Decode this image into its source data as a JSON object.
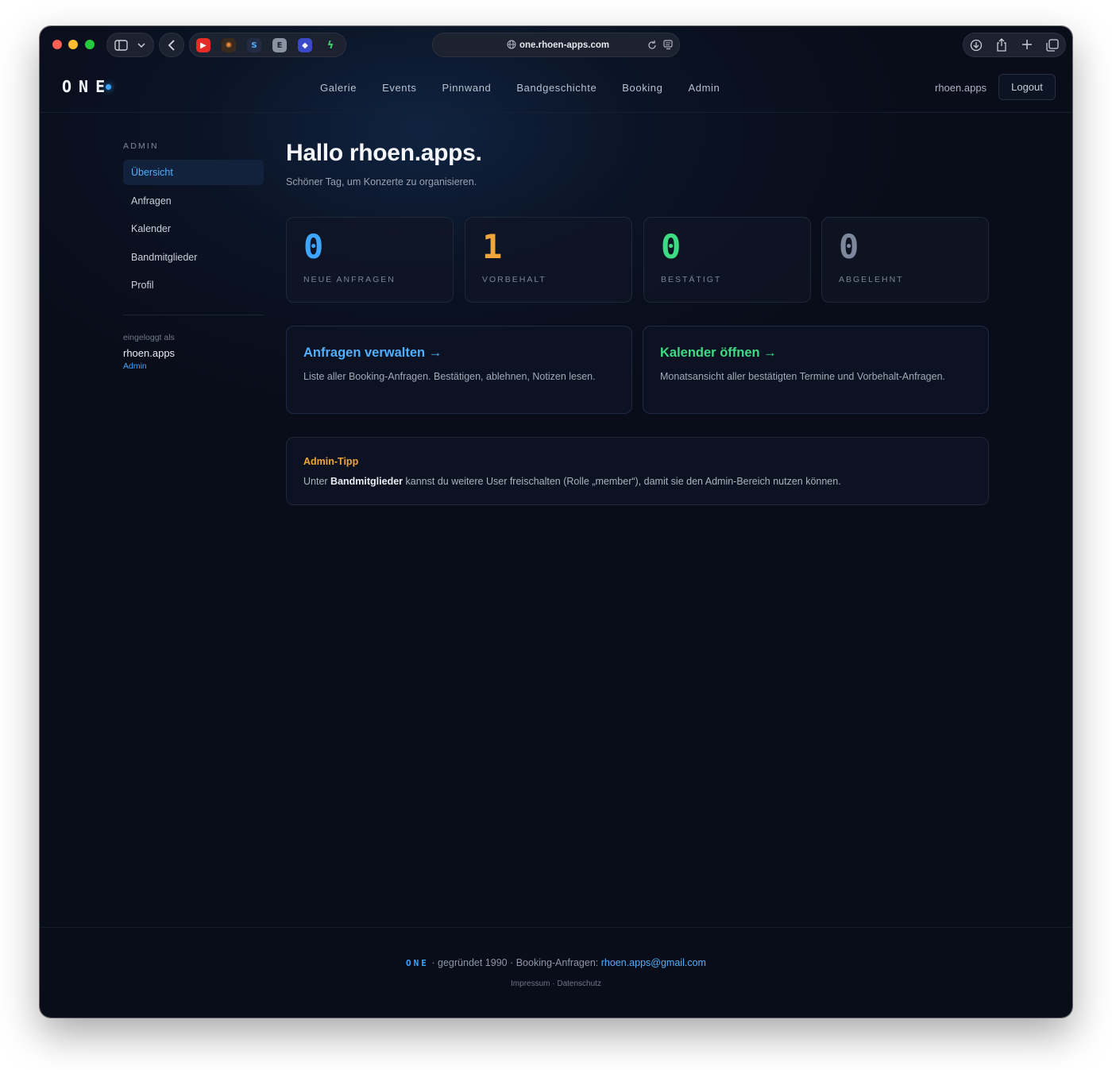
{
  "browser": {
    "url": "one.rhoen-apps.com",
    "extensions": [
      "youtube-icon",
      "spark-icon",
      "s-extension-icon",
      "e-extension-icon",
      "shield-extension-icon",
      "bolt-extension-icon"
    ]
  },
  "site": {
    "logo": "ONE",
    "nav": [
      "Galerie",
      "Events",
      "Pinnwand",
      "Bandgeschichte",
      "Booking",
      "Admin"
    ],
    "user": "rhoen.apps",
    "logout": "Logout"
  },
  "sidebar": {
    "heading": "ADMIN",
    "items": [
      {
        "label": "Übersicht",
        "active": true
      },
      {
        "label": "Anfragen"
      },
      {
        "label": "Kalender"
      },
      {
        "label": "Bandmitglieder"
      },
      {
        "label": "Profil"
      }
    ],
    "login_label": "eingeloggt als",
    "login_user": "rhoen.apps",
    "login_role": "Admin"
  },
  "main": {
    "greeting": "Hallo rhoen.apps.",
    "subgreeting": "Schöner Tag, um Konzerte zu organisieren.",
    "stats": [
      {
        "value": "0",
        "label": "NEUE ANFRAGEN",
        "color": "#3ea5ff"
      },
      {
        "value": "1",
        "label": "VORBEHALT",
        "color": "#f0a63a"
      },
      {
        "value": "0",
        "label": "BESTÄTIGT",
        "color": "#3ddc84"
      },
      {
        "value": "0",
        "label": "ABGELEHNT",
        "color": "#7d879b"
      }
    ],
    "actions": [
      {
        "title": "Anfragen verwalten →",
        "desc": "Liste aller Booking-Anfragen. Bestätigen, ablehnen, Notizen lesen.",
        "color": "#4fb0ff"
      },
      {
        "title": "Kalender öffnen →",
        "desc": "Monatsansicht aller bestätigten Termine und Vorbehalt-Anfragen.",
        "color": "#3ddc84"
      }
    ],
    "tip": {
      "title": "Admin-Tipp",
      "text_before": "Unter ",
      "text_bold": "Bandmitglieder",
      "text_after": " kannst du weitere User freischalten (Rolle „member“), damit sie den Admin-Bereich nutzen können."
    }
  },
  "footer": {
    "logo": "ONE",
    "text": " · gegründet 1990 · Booking-Anfragen: ",
    "email": "rhoen.apps@gmail.com",
    "impressum": "Impressum",
    "separator": " · ",
    "datenschutz": "Datenschutz"
  }
}
